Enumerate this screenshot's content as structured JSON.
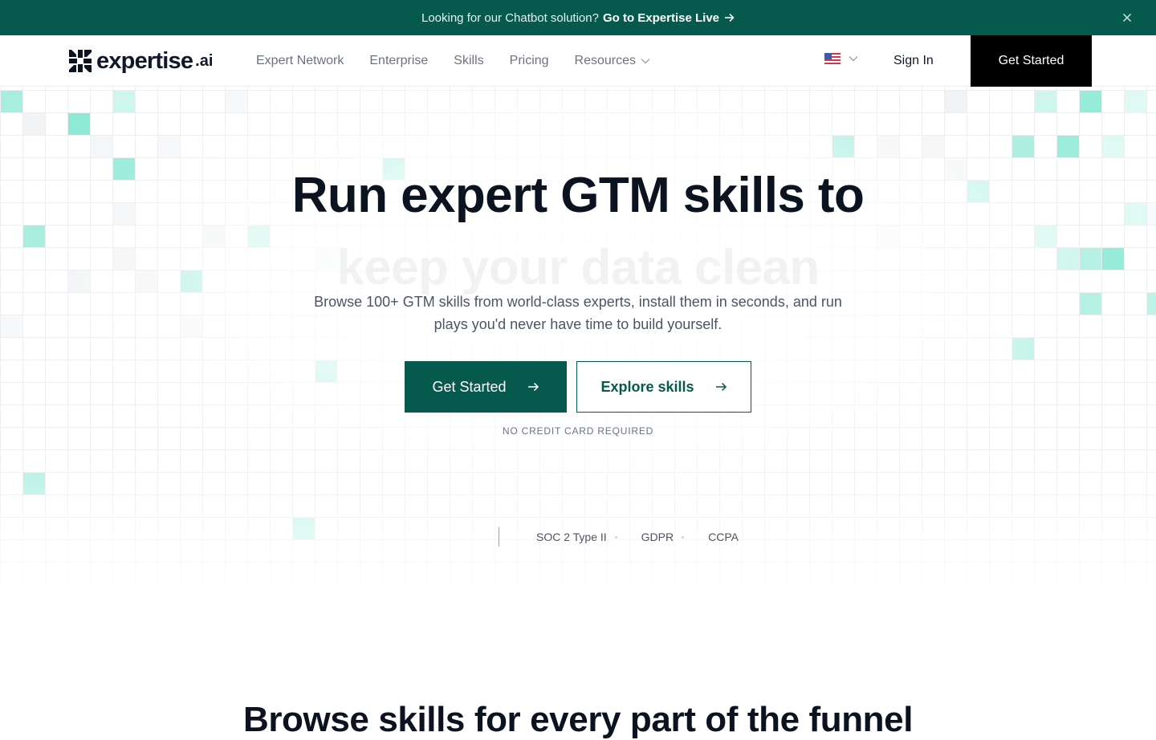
{
  "banner": {
    "text": "Looking for our Chatbot solution?",
    "link_label": "Go to Expertise Live",
    "arrow_icon": "arrow-right-icon",
    "close_icon": "close-icon",
    "bg_color": "#065a4d"
  },
  "nav": {
    "logo_word": "expertise",
    "logo_tld": ".ai",
    "items": [
      {
        "label": "Expert Network"
      },
      {
        "label": "Enterprise"
      },
      {
        "label": "Skills"
      },
      {
        "label": "Pricing"
      },
      {
        "label": "Resources",
        "has_dropdown": true
      }
    ],
    "locale_icon": "us-flag-icon",
    "sign_in": "Sign In",
    "cta": "Get Started"
  },
  "hero": {
    "title": "Run expert GTM skills to",
    "rotating_text": "keep your data clean",
    "subtitle": "Browse 100+ GTM skills from world-class experts, install them in seconds, and run plays you'd never have time to build yourself.",
    "primary_cta": "Get Started",
    "secondary_cta": "Explore skills",
    "note": "NO CREDIT CARD REQUIRED",
    "compliance": [
      "SOC 2 Type II",
      "GDPR",
      "CCPA"
    ],
    "accent_color": "#065a4d",
    "tile_color": "#5ee0c4"
  },
  "next_section": {
    "title": "Browse skills for every part of the funnel"
  }
}
